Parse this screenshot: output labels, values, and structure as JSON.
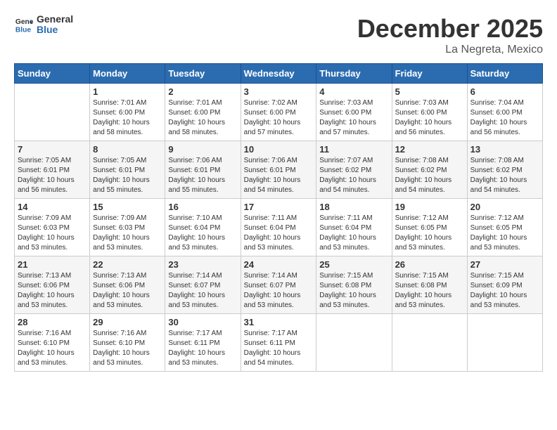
{
  "header": {
    "logo_line1": "General",
    "logo_line2": "Blue",
    "month_title": "December 2025",
    "location": "La Negreta, Mexico"
  },
  "columns": [
    "Sunday",
    "Monday",
    "Tuesday",
    "Wednesday",
    "Thursday",
    "Friday",
    "Saturday"
  ],
  "weeks": [
    [
      {
        "day": "",
        "info": ""
      },
      {
        "day": "1",
        "info": "Sunrise: 7:01 AM\nSunset: 6:00 PM\nDaylight: 10 hours\nand 58 minutes."
      },
      {
        "day": "2",
        "info": "Sunrise: 7:01 AM\nSunset: 6:00 PM\nDaylight: 10 hours\nand 58 minutes."
      },
      {
        "day": "3",
        "info": "Sunrise: 7:02 AM\nSunset: 6:00 PM\nDaylight: 10 hours\nand 57 minutes."
      },
      {
        "day": "4",
        "info": "Sunrise: 7:03 AM\nSunset: 6:00 PM\nDaylight: 10 hours\nand 57 minutes."
      },
      {
        "day": "5",
        "info": "Sunrise: 7:03 AM\nSunset: 6:00 PM\nDaylight: 10 hours\nand 56 minutes."
      },
      {
        "day": "6",
        "info": "Sunrise: 7:04 AM\nSunset: 6:00 PM\nDaylight: 10 hours\nand 56 minutes."
      }
    ],
    [
      {
        "day": "7",
        "info": "Sunrise: 7:05 AM\nSunset: 6:01 PM\nDaylight: 10 hours\nand 56 minutes."
      },
      {
        "day": "8",
        "info": "Sunrise: 7:05 AM\nSunset: 6:01 PM\nDaylight: 10 hours\nand 55 minutes."
      },
      {
        "day": "9",
        "info": "Sunrise: 7:06 AM\nSunset: 6:01 PM\nDaylight: 10 hours\nand 55 minutes."
      },
      {
        "day": "10",
        "info": "Sunrise: 7:06 AM\nSunset: 6:01 PM\nDaylight: 10 hours\nand 54 minutes."
      },
      {
        "day": "11",
        "info": "Sunrise: 7:07 AM\nSunset: 6:02 PM\nDaylight: 10 hours\nand 54 minutes."
      },
      {
        "day": "12",
        "info": "Sunrise: 7:08 AM\nSunset: 6:02 PM\nDaylight: 10 hours\nand 54 minutes."
      },
      {
        "day": "13",
        "info": "Sunrise: 7:08 AM\nSunset: 6:02 PM\nDaylight: 10 hours\nand 54 minutes."
      }
    ],
    [
      {
        "day": "14",
        "info": "Sunrise: 7:09 AM\nSunset: 6:03 PM\nDaylight: 10 hours\nand 53 minutes."
      },
      {
        "day": "15",
        "info": "Sunrise: 7:09 AM\nSunset: 6:03 PM\nDaylight: 10 hours\nand 53 minutes."
      },
      {
        "day": "16",
        "info": "Sunrise: 7:10 AM\nSunset: 6:04 PM\nDaylight: 10 hours\nand 53 minutes."
      },
      {
        "day": "17",
        "info": "Sunrise: 7:11 AM\nSunset: 6:04 PM\nDaylight: 10 hours\nand 53 minutes."
      },
      {
        "day": "18",
        "info": "Sunrise: 7:11 AM\nSunset: 6:04 PM\nDaylight: 10 hours\nand 53 minutes."
      },
      {
        "day": "19",
        "info": "Sunrise: 7:12 AM\nSunset: 6:05 PM\nDaylight: 10 hours\nand 53 minutes."
      },
      {
        "day": "20",
        "info": "Sunrise: 7:12 AM\nSunset: 6:05 PM\nDaylight: 10 hours\nand 53 minutes."
      }
    ],
    [
      {
        "day": "21",
        "info": "Sunrise: 7:13 AM\nSunset: 6:06 PM\nDaylight: 10 hours\nand 53 minutes."
      },
      {
        "day": "22",
        "info": "Sunrise: 7:13 AM\nSunset: 6:06 PM\nDaylight: 10 hours\nand 53 minutes."
      },
      {
        "day": "23",
        "info": "Sunrise: 7:14 AM\nSunset: 6:07 PM\nDaylight: 10 hours\nand 53 minutes."
      },
      {
        "day": "24",
        "info": "Sunrise: 7:14 AM\nSunset: 6:07 PM\nDaylight: 10 hours\nand 53 minutes."
      },
      {
        "day": "25",
        "info": "Sunrise: 7:15 AM\nSunset: 6:08 PM\nDaylight: 10 hours\nand 53 minutes."
      },
      {
        "day": "26",
        "info": "Sunrise: 7:15 AM\nSunset: 6:08 PM\nDaylight: 10 hours\nand 53 minutes."
      },
      {
        "day": "27",
        "info": "Sunrise: 7:15 AM\nSunset: 6:09 PM\nDaylight: 10 hours\nand 53 minutes."
      }
    ],
    [
      {
        "day": "28",
        "info": "Sunrise: 7:16 AM\nSunset: 6:10 PM\nDaylight: 10 hours\nand 53 minutes."
      },
      {
        "day": "29",
        "info": "Sunrise: 7:16 AM\nSunset: 6:10 PM\nDaylight: 10 hours\nand 53 minutes."
      },
      {
        "day": "30",
        "info": "Sunrise: 7:17 AM\nSunset: 6:11 PM\nDaylight: 10 hours\nand 53 minutes."
      },
      {
        "day": "31",
        "info": "Sunrise: 7:17 AM\nSunset: 6:11 PM\nDaylight: 10 hours\nand 54 minutes."
      },
      {
        "day": "",
        "info": ""
      },
      {
        "day": "",
        "info": ""
      },
      {
        "day": "",
        "info": ""
      }
    ]
  ]
}
